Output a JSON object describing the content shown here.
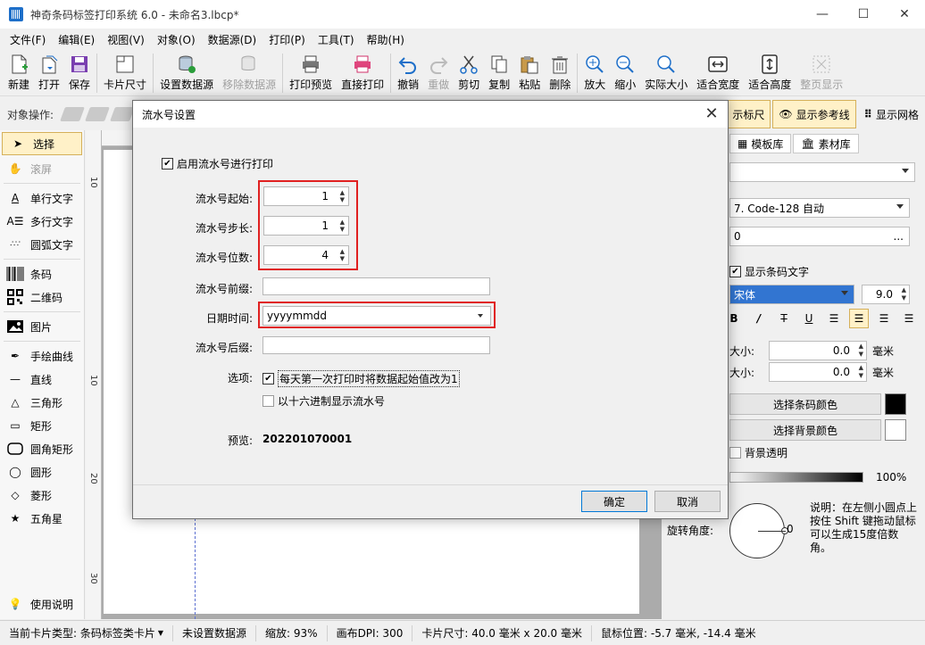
{
  "window": {
    "title": "神奇条码标签打印系统 6.0 - 未命名3.lbcp*",
    "minimize": "—",
    "maximize": "☐",
    "close": "✕"
  },
  "menu": [
    "文件(F)",
    "编辑(E)",
    "视图(V)",
    "对象(O)",
    "数据源(D)",
    "打印(P)",
    "工具(T)",
    "帮助(H)"
  ],
  "toolbar": {
    "new": "新建",
    "open": "打开",
    "save": "保存",
    "card_size": "卡片尺寸",
    "set_datasource": "设置数据源",
    "remove_datasource": "移除数据源",
    "print_preview": "打印预览",
    "direct_print": "直接打印",
    "undo": "撤销",
    "redo": "重做",
    "cut": "剪切",
    "copy": "复制",
    "paste": "粘贴",
    "delete": "删除",
    "zoom_in": "放大",
    "zoom_out": "缩小",
    "actual_size": "实际大小",
    "fit_width": "适合宽度",
    "fit_height": "适合高度",
    "full_page": "整页显示"
  },
  "ops": {
    "label": "对象操作:",
    "show_ruler": "示标尺",
    "show_guides": "显示参考线",
    "show_grid": "显示网格"
  },
  "tools": {
    "select": "选择",
    "scroll": "滚屏",
    "single_text": "单行文字",
    "multi_text": "多行文字",
    "arc_text": "圆弧文字",
    "barcode": "条码",
    "qrcode": "二维码",
    "image": "图片",
    "freehand": "手绘曲线",
    "line": "直线",
    "triangle": "三角形",
    "rect": "矩形",
    "round_rect": "圆角矩形",
    "ellipse": "圆形",
    "diamond": "菱形",
    "star": "五角星",
    "help": "使用说明"
  },
  "ruler": {
    "n1": "10",
    "n2": "10",
    "n3": "20",
    "n4": "30"
  },
  "right_panel": {
    "tab_templates": "模板库",
    "tab_materials": "素材库",
    "barcode_type": "7. Code-128 自动",
    "value_suffix": "0",
    "ellipsis": "...",
    "show_barcode_text": "显示条码文字",
    "font_name": "宋体",
    "font_size": "9.0",
    "bold": "B",
    "italic": "/",
    "strike": "T",
    "underline": "U",
    "size_label_1": "大小:",
    "size_val_1": "0.0",
    "size_unit_1": "毫米",
    "size_label_2": "大小:",
    "size_val_2": "0.0",
    "size_unit_2": "毫米",
    "barcode_color_btn": "选择条码颜色",
    "background_color_btn": "选择背景颜色",
    "bg_transparent": "背景透明",
    "opacity": "100%",
    "rotation_label": "旋转角度:",
    "rotation_value": "0",
    "rotation_help": "说明：在左侧小圆点上按住 Shift 键拖动鼠标可以生成15度倍数角。",
    "barcode_color": "#000000",
    "background_color": "#ffffff"
  },
  "status": {
    "card_type": "当前卡片类型: 条码标签类卡片",
    "datasource": "未设置数据源",
    "zoom": "缩放: 93%",
    "dpi": "画布DPI: 300",
    "card_size": "卡片尺寸: 40.0 毫米 x 20.0 毫米",
    "mouse_pos": "鼠标位置: -5.7 毫米, -14.4 毫米"
  },
  "dialog": {
    "title": "流水号设置",
    "enable_label": "启用流水号进行打印",
    "start_label": "流水号起始:",
    "start_value": "1",
    "step_label": "流水号步长:",
    "step_value": "1",
    "digits_label": "流水号位数:",
    "digits_value": "4",
    "prefix_label": "流水号前缀:",
    "date_label": "日期时间:",
    "date_value": "yyyymmdd",
    "suffix_label": "流水号后缀:",
    "options_label": "选项:",
    "option_reset_daily": "每天第一次打印时将数据起始值改为1",
    "option_hex": "以十六进制显示流水号",
    "preview_label": "预览:",
    "preview_value": "202201070001",
    "ok": "确定",
    "cancel": "取消",
    "highlight_color": "#e02020"
  }
}
